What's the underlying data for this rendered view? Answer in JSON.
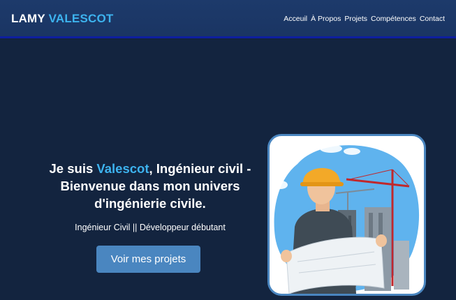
{
  "header": {
    "logo_first": "LAMY",
    "logo_second": "VALESCOT",
    "nav": [
      "Acceuil",
      "À Propos",
      "Projets",
      "Compétences",
      "Contact"
    ]
  },
  "hero": {
    "title_prefix": "Je suis ",
    "title_name": "Valescot",
    "title_rest": ", Ingénieur civil - Bienvenue dans mon univers d'ingénierie civile.",
    "subtitle": "Ingénieur Civil || Développeur débutant",
    "cta_label": "Voir mes projets"
  },
  "illustration": {
    "icon": "civil-engineer-illustration"
  },
  "colors": {
    "background": "#13243f",
    "header": "#1d3a6b",
    "accent": "#3db3ef",
    "button": "#4a86c0"
  }
}
